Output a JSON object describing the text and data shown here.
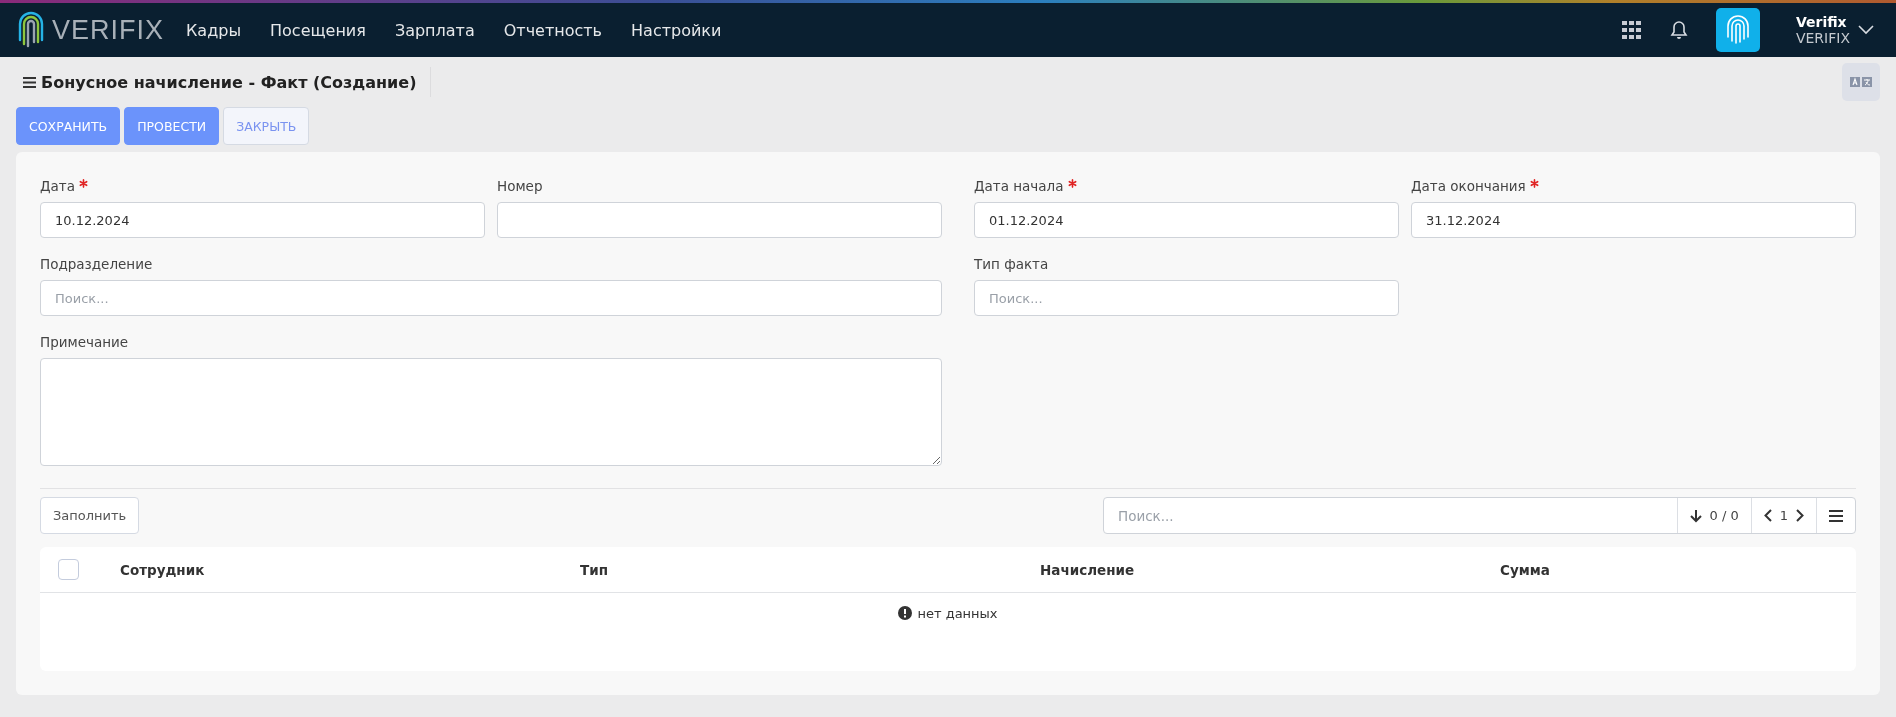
{
  "navbar": {
    "logo": "VERIFIX",
    "menu": [
      {
        "label": "Кадры"
      },
      {
        "label": "Посещения"
      },
      {
        "label": "Зарплата"
      },
      {
        "label": "Отчетность"
      },
      {
        "label": "Настройки"
      }
    ],
    "user": {
      "name": "Verifix",
      "company": "VERIFIX"
    }
  },
  "page": {
    "title": "Бонусное начисление - Факт (Создание)"
  },
  "actions": [
    {
      "label": "СОХРАНИТЬ",
      "kind": "primary"
    },
    {
      "label": "ПРОВЕСТИ",
      "kind": "primary"
    },
    {
      "label": "ЗАКРЫТЬ",
      "kind": "outline"
    }
  ],
  "form": {
    "fields": [
      {
        "label": "Дата",
        "required": true,
        "value": "10.12.2024"
      },
      {
        "label": "Номер",
        "required": false
      },
      {
        "label": "Дата начала",
        "required": true,
        "value": "01.12.2024"
      },
      {
        "label": "Дата окончания",
        "required": true,
        "value": "31.12.2024"
      },
      {
        "label": "Подразделение",
        "required": false,
        "placeholder": "Поиск..."
      },
      {
        "label": "Тип факта",
        "required": false,
        "placeholder": "Поиск..."
      },
      {
        "label": "Примечание",
        "required": false,
        "kind": "textarea"
      }
    ]
  },
  "grid": {
    "fill_button": "Заполнить",
    "search": {
      "placeholder": "Поиск..."
    },
    "count": "0 / 0",
    "page": "1",
    "table": {
      "select_all": {
        "checked": false
      },
      "columns": [
        "Сотрудник",
        "Тип",
        "Начисление",
        "Сумма"
      ],
      "empty": "нет данных"
    }
  }
}
